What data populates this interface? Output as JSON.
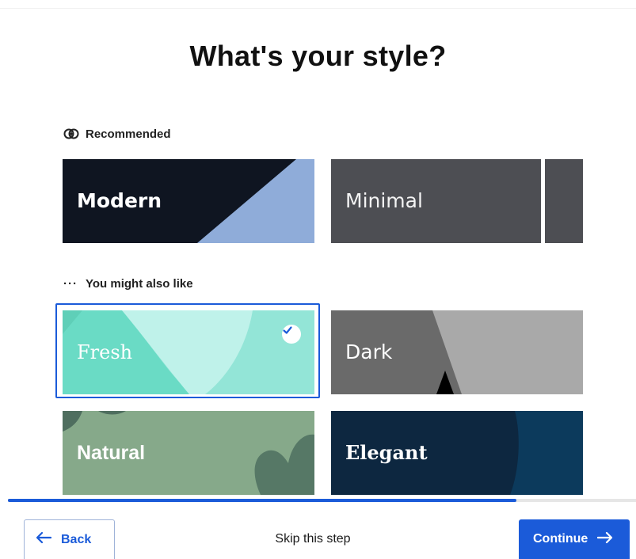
{
  "page": {
    "title": "What's your style?"
  },
  "sections": {
    "recommended_label": "Recommended",
    "also_like_label": "You might also like"
  },
  "styles": {
    "modern": "Modern",
    "minimal": "Minimal",
    "fresh": "Fresh",
    "dark": "Dark",
    "natural": "Natural",
    "elegant": "Elegant"
  },
  "selected_style": "Fresh",
  "progress": {
    "fraction": 0.81
  },
  "footer": {
    "back_label": "Back",
    "skip_label": "Skip this step",
    "continue_label": "Continue"
  },
  "colors": {
    "accent": "#1b5bd9"
  },
  "icons": {
    "recommended": "sparkle-badge-icon",
    "also_like": "ellipsis-icon",
    "back": "arrow-left-icon",
    "continue": "arrow-right-icon",
    "selected": "checkmark-icon"
  }
}
